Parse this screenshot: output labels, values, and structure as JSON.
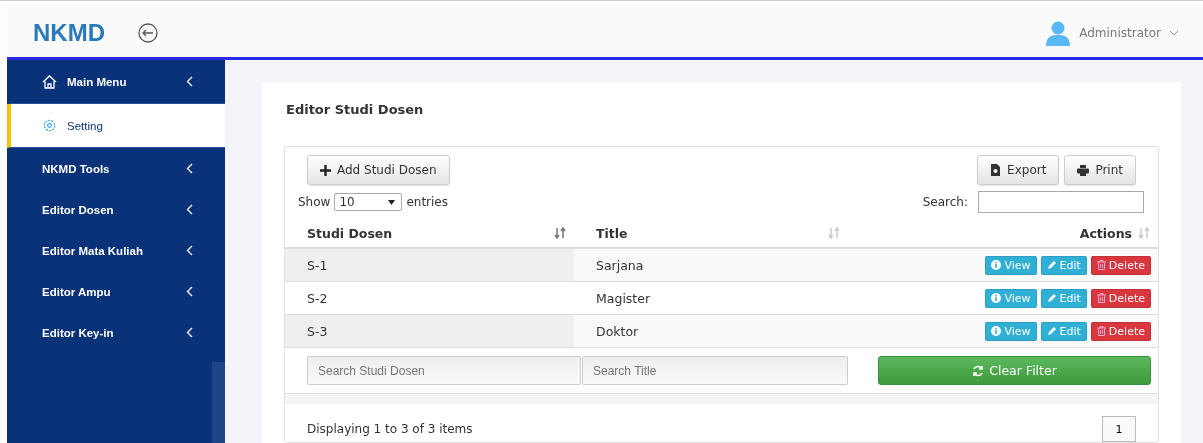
{
  "header": {
    "logo": "NKMD",
    "user": "Administrator"
  },
  "sidebar": {
    "items": [
      {
        "label": "Main Menu",
        "kind": "home",
        "selected": false
      },
      {
        "label": "Setting",
        "kind": "gear",
        "selected": true
      },
      {
        "label": "NKMD Tools",
        "kind": "plain",
        "selected": false
      },
      {
        "label": "Editor Dosen",
        "kind": "plain",
        "selected": false
      },
      {
        "label": "Editor Mata Kuliah",
        "kind": "plain",
        "selected": false
      },
      {
        "label": "Editor Ampu",
        "kind": "plain",
        "selected": false
      },
      {
        "label": "Editor Key-in",
        "kind": "plain",
        "selected": false
      }
    ]
  },
  "page": {
    "title": "Editor Studi Dosen"
  },
  "toolbar": {
    "add_button": "Add Studi Dosen",
    "export_button": "Export",
    "print_button": "Print"
  },
  "length": {
    "prefix": "Show",
    "value": "10",
    "suffix": "entries"
  },
  "search": {
    "label": "Search:"
  },
  "table": {
    "columns": [
      "Studi Dosen",
      "Title",
      "Actions"
    ],
    "rows": [
      {
        "cells": [
          "S-1",
          "Sarjana"
        ],
        "actions": [
          "View",
          "Edit",
          "Delete"
        ]
      },
      {
        "cells": [
          "S-2",
          "Magister"
        ],
        "actions": [
          "View",
          "Edit",
          "Delete"
        ]
      },
      {
        "cells": [
          "S-3",
          "Doktor"
        ],
        "actions": [
          "View",
          "Edit",
          "Delete"
        ]
      }
    ],
    "filters": [
      {
        "placeholder": "Search Studi Dosen"
      },
      {
        "placeholder": "Search Title"
      }
    ],
    "clear_button": "Clear Filter"
  },
  "footer": {
    "info": "Displaying 1 to 3 of 3 items",
    "pages": [
      {
        "label": "1",
        "selected": true
      }
    ]
  }
}
